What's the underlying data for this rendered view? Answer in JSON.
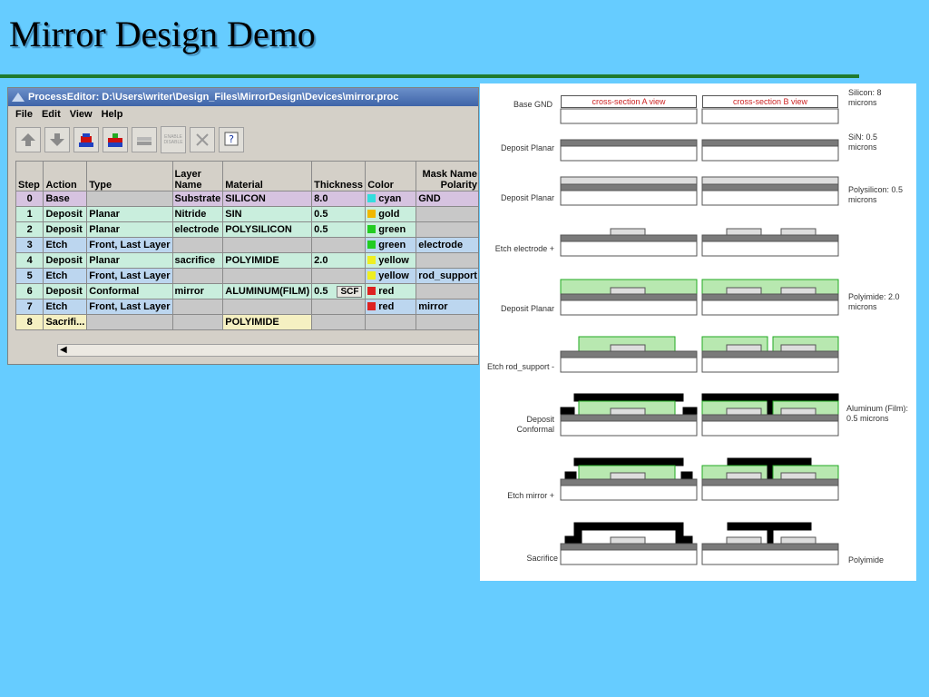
{
  "slide": {
    "title": "Mirror Design Demo"
  },
  "editor": {
    "title": "ProcessEditor: D:\\Users\\writer\\Design_Files\\MirrorDesign\\Devices\\mirror.proc",
    "menu": [
      "File",
      "Edit",
      "View",
      "Help"
    ],
    "toolbar": {
      "enable_disable_label": "ENABLE DISABLE"
    },
    "columns": [
      "Step",
      "Action",
      "Type",
      "Layer Name",
      "Material",
      "Thickness",
      "Color",
      "Mask Name Polarity"
    ],
    "rows": [
      {
        "step": "0",
        "action": "Base",
        "type": "",
        "layer": "Substrate",
        "material": "SILICON",
        "thickness": "8.0",
        "color": "cyan",
        "color_hex": "#33dddd",
        "mask": "GND",
        "style": "r-lav"
      },
      {
        "step": "1",
        "action": "Deposit",
        "type": "Planar",
        "layer": "Nitride",
        "material": "SIN",
        "thickness": "0.5",
        "color": "gold",
        "color_hex": "#f0b800",
        "mask": "",
        "style": "r-mint"
      },
      {
        "step": "2",
        "action": "Deposit",
        "type": "Planar",
        "layer": "electrode",
        "material": "POLYSILICON",
        "thickness": "0.5",
        "color": "green",
        "color_hex": "#22cc22",
        "mask": "",
        "style": "r-mint"
      },
      {
        "step": "3",
        "action": "Etch",
        "type": "Front, Last Layer",
        "layer": "",
        "material": "",
        "thickness": "",
        "color": "green",
        "color_hex": "#22cc22",
        "mask": "electrode",
        "style": "r-blue"
      },
      {
        "step": "4",
        "action": "Deposit",
        "type": "Planar",
        "layer": "sacrifice",
        "material": "POLYIMIDE",
        "thickness": "2.0",
        "color": "yellow",
        "color_hex": "#eeee22",
        "mask": "",
        "style": "r-mint"
      },
      {
        "step": "5",
        "action": "Etch",
        "type": "Front, Last Layer",
        "layer": "",
        "material": "",
        "thickness": "",
        "color": "yellow",
        "color_hex": "#eeee22",
        "mask": "rod_support",
        "style": "r-blue"
      },
      {
        "step": "6",
        "action": "Deposit",
        "type": "Conformal",
        "layer": "mirror",
        "material": "ALUMINUM(FILM)",
        "thickness": "0.5",
        "color": "red",
        "color_hex": "#dd2222",
        "mask": "",
        "style": "r-mint",
        "scf": "SCF"
      },
      {
        "step": "7",
        "action": "Etch",
        "type": "Front, Last Layer",
        "layer": "",
        "material": "",
        "thickness": "",
        "color": "red",
        "color_hex": "#dd2222",
        "mask": "mirror",
        "style": "r-blue"
      },
      {
        "step": "8",
        "action": "Sacrifi...",
        "type": "",
        "layer": "",
        "material": "POLYIMIDE",
        "thickness": "",
        "color": "",
        "color_hex": "",
        "mask": "",
        "style": "r-yel"
      }
    ]
  },
  "cross_section": {
    "header_a": "cross-section A view",
    "header_b": "cross-section B view",
    "steps": [
      "Base GND",
      "Deposit Planar",
      "Deposit Planar",
      "Etch electrode +",
      "Deposit Planar",
      "Etch rod_support -",
      "Deposit Conformal",
      "Etch mirror +",
      "Sacrifice"
    ],
    "notes": [
      "Silicon: 8 microns",
      "SiN: 0.5 microns",
      "Polysilicon: 0.5 microns",
      "Polyimide: 2.0 microns",
      "Aluminum (Film): 0.5 microns",
      "Polyimide"
    ],
    "colors": {
      "substrate": "#ffffff",
      "nitride": "#7a7a7a",
      "poly": "#dddddd",
      "polyimide": "#b8e8b0",
      "polyimide_edge": "#22aa22",
      "metal": "#000000"
    }
  }
}
